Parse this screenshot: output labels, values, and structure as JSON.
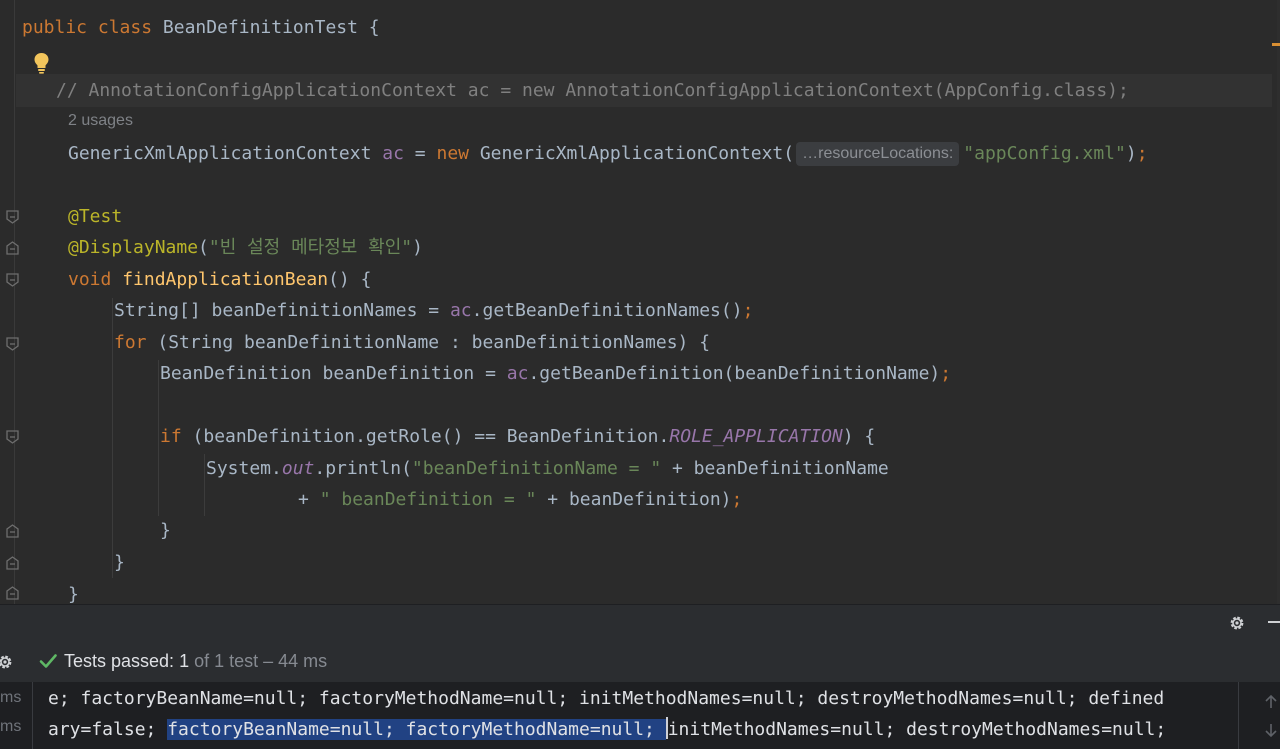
{
  "editor": {
    "lines": {
      "class_decl_kw": "public class ",
      "class_decl_name": "BeanDefinitionTest {",
      "comment": "// AnnotationConfigApplicationContext ac = new AnnotationConfigApplicationContext(AppConfig.class);",
      "usages": "2 usages",
      "ctx_type": "GenericXmlApplicationContext ",
      "ctx_var": "ac",
      "ctx_eq": " = ",
      "ctx_new": "new",
      "ctx_call": " GenericXmlApplicationContext(",
      "ctx_hint": "…resourceLocations:",
      "ctx_str": "\"appConfig.xml\"",
      "ctx_end": ")",
      "semi": ";",
      "test_ann": "@Test",
      "display_ann": "@DisplayName",
      "display_open": "(",
      "display_str": "\"빈 설정 메타정보 확인\"",
      "display_close": ")",
      "void_kw": "void ",
      "method_name": "findApplicationBean",
      "method_rest": "() {",
      "names_decl": "String[] beanDefinitionNames = ",
      "names_var": "ac",
      "names_call": ".getBeanDefinitionNames()",
      "for_kw": "for",
      "for_rest": " (String beanDefinitionName : beanDefinitionNames) {",
      "bd_decl": "BeanDefinition beanDefinition = ",
      "bd_var": "ac",
      "bd_call": ".getBeanDefinition(beanDefinitionName)",
      "if_kw": "if",
      "if_mid": " (beanDefinition.getRole() == BeanDefinition.",
      "if_const": "ROLE_APPLICATION",
      "if_end": ") {",
      "print_sys": "System.",
      "print_out": "out",
      "print_call": ".println(",
      "print_str": "\"beanDefinitionName = \"",
      "print_rest": " + beanDefinitionName",
      "cont_plus": "+ ",
      "cont_str": "\" beanDefinition = \"",
      "cont_rest": " + beanDefinition)",
      "close_if": "}",
      "close_for": "}",
      "close_method": "}"
    }
  },
  "test_panel": {
    "status_prefix": "Tests passed: ",
    "passed_count": "1",
    "status_suffix": " of 1 test – 44 ms",
    "ms_label_1": "ms",
    "ms_label_2": "ms",
    "console_line_1": "e; factoryBeanName=null; factoryMethodName=null; initMethodNames=null; destroyMethodNames=null; defined",
    "console_line_2_pre": "ary=false; ",
    "console_line_2_sel": "factoryBeanName=null; factoryMethodName=null; ",
    "console_line_2_post": "initMethodNames=null; destroyMethodNames=null;"
  },
  "icons": {
    "bulb": "lightbulb-icon",
    "settings": "gear-icon",
    "check": "check-icon",
    "fold": "fold-icon"
  },
  "colors": {
    "keyword": "#cc7832",
    "function": "#ffc66d",
    "annotation": "#bbb529",
    "string": "#6a8759",
    "comment": "#808080",
    "field": "#9876aa",
    "selection": "#214283",
    "pass": "#5fb865"
  }
}
